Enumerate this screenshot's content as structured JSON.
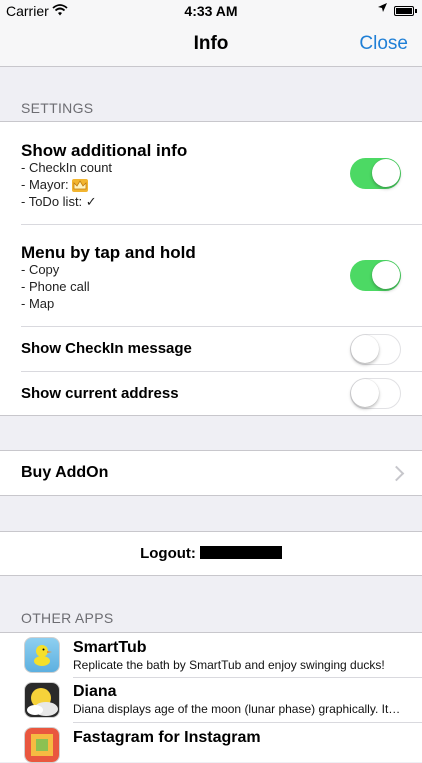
{
  "status_bar": {
    "carrier": "Carrier",
    "time": "4:33 AM",
    "icons": [
      "wifi-icon",
      "location-arrow-icon",
      "battery-icon"
    ]
  },
  "nav": {
    "title": "Info",
    "close_label": "Close",
    "accent": "#1f7fd6"
  },
  "settings": {
    "header": "SETTINGS",
    "items": [
      {
        "title": "Show additional info",
        "lines": [
          "- CheckIn count",
          "- Mayor:",
          "- ToDo list: ✓"
        ],
        "crown_icon": "crown-icon",
        "enabled": true
      },
      {
        "title": "Menu by tap and hold",
        "lines": [
          "- Copy",
          "- Phone call",
          "- Map"
        ],
        "enabled": true
      },
      {
        "title": "Show CheckIn message",
        "enabled": false
      },
      {
        "title": "Show current address",
        "enabled": false
      }
    ],
    "toggle_on_color": "#4cd964"
  },
  "addon": {
    "label": "Buy AddOn"
  },
  "logout": {
    "label": "Logout:"
  },
  "other_apps": {
    "header": "OTHER APPS",
    "items": [
      {
        "title": "SmartTub",
        "description": "Replicate the bath by SmartTub and enjoy swinging ducks!",
        "icon": "rubber-duck-icon"
      },
      {
        "title": "Diana",
        "description": "Diana displays age of the moon (lunar phase) graphically. It…",
        "icon": "moon-phase-icon"
      },
      {
        "title": "Fastagram for Instagram",
        "description": "",
        "icon": "fastagram-icon"
      }
    ]
  }
}
